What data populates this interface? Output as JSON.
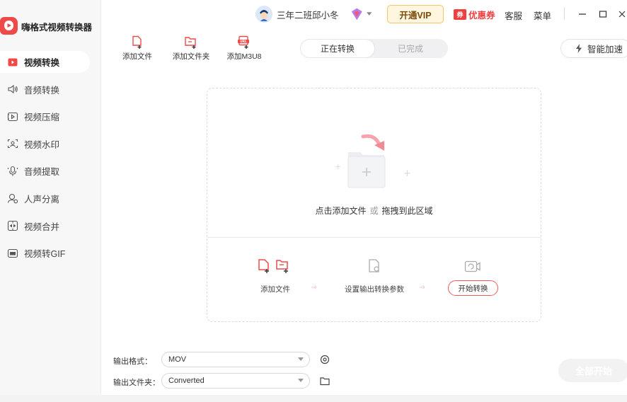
{
  "app": {
    "title": "嗨格式视频转换器"
  },
  "sidebar": {
    "items": [
      {
        "label": "视频转换",
        "icon": "video-convert-icon",
        "active": true
      },
      {
        "label": "音频转换",
        "icon": "audio-convert-icon"
      },
      {
        "label": "视频压缩",
        "icon": "video-compress-icon"
      },
      {
        "label": "视频水印",
        "icon": "video-watermark-icon"
      },
      {
        "label": "音频提取",
        "icon": "audio-extract-icon"
      },
      {
        "label": "人声分离",
        "icon": "voice-separate-icon"
      },
      {
        "label": "视频合并",
        "icon": "video-merge-icon"
      },
      {
        "label": "视频转GIF",
        "icon": "video-gif-icon"
      }
    ]
  },
  "titlebar": {
    "user_name": "三年二班邱小冬",
    "vip_button": "开通VIP",
    "coupon_badge": "券",
    "coupon": "优惠券",
    "service": "客服",
    "menu": "菜单"
  },
  "toolbar": {
    "add_file": "添加文件",
    "add_folder": "添加文件夹",
    "add_m3u8": "添加M3U8",
    "m3u8_badge": "URL"
  },
  "tabs": {
    "converting": "正在转换",
    "completed": "已完成"
  },
  "accelerate": "智能加速",
  "dropzone": {
    "hint_click": "点击添加文件",
    "hint_or": "或",
    "hint_drag": "拖拽到此区域",
    "step1": "添加文件",
    "step2": "设置输出转换参数",
    "step3": "开始转换"
  },
  "output": {
    "format_label": "输出格式：",
    "format_value": "MOV",
    "folder_label": "输出文件夹：",
    "folder_value": "Converted"
  },
  "start_all": "全部开始",
  "colors": {
    "accent": "#ef4a4a",
    "vip_border": "#f3c46a",
    "vip_bg": "#fff6df"
  }
}
